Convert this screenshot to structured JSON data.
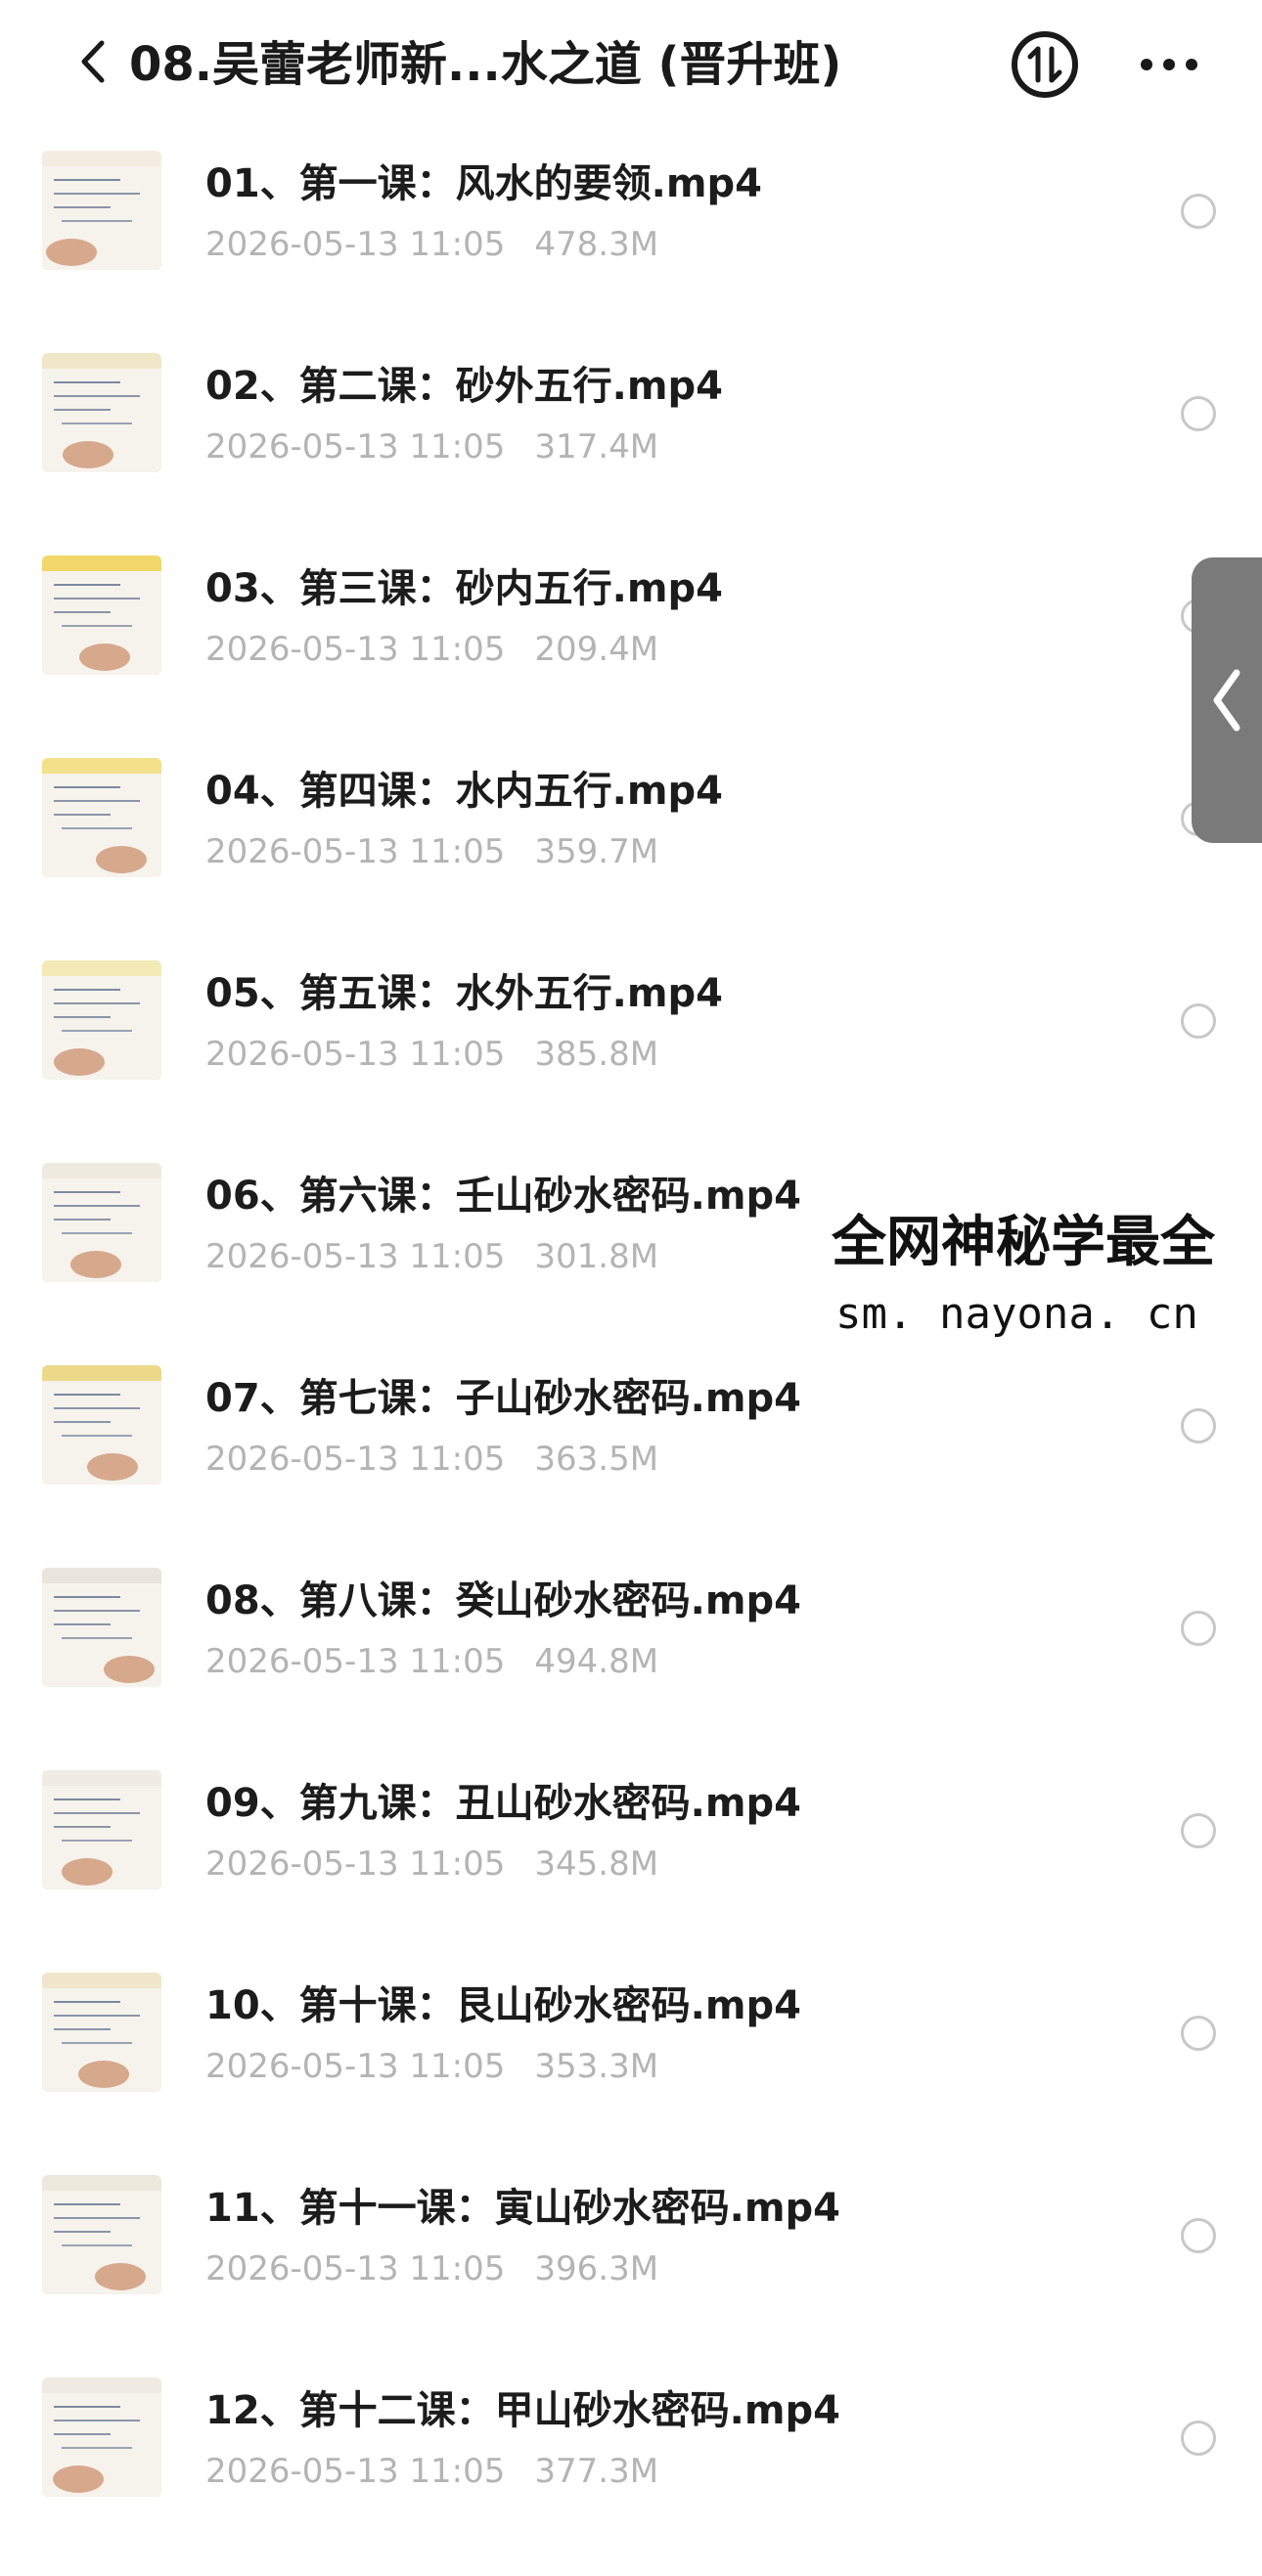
{
  "header": {
    "title": "08.吴蕾老师新...水之道 (晋升班)",
    "back_icon": "chevron-left-icon",
    "sort_icon": "sort-swap-icon",
    "more_icon": "more-dots-icon"
  },
  "files": [
    {
      "name": "01、第一课：风水的要领.mp4",
      "date": "2026-05-13 11:05",
      "size": "478.3M"
    },
    {
      "name": "02、第二课：砂外五行.mp4",
      "date": "2026-05-13 11:05",
      "size": "317.4M"
    },
    {
      "name": "03、第三课：砂内五行.mp4",
      "date": "2026-05-13 11:05",
      "size": "209.4M"
    },
    {
      "name": "04、第四课：水内五行.mp4",
      "date": "2026-05-13 11:05",
      "size": "359.7M"
    },
    {
      "name": "05、第五课：水外五行.mp4",
      "date": "2026-05-13 11:05",
      "size": "385.8M"
    },
    {
      "name": "06、第六课：壬山砂水密码.mp4",
      "date": "2026-05-13 11:05",
      "size": "301.8M"
    },
    {
      "name": "07、第七课：子山砂水密码.mp4",
      "date": "2026-05-13 11:05",
      "size": "363.5M"
    },
    {
      "name": "08、第八课：癸山砂水密码.mp4",
      "date": "2026-05-13 11:05",
      "size": "494.8M"
    },
    {
      "name": "09、第九课：丑山砂水密码.mp4",
      "date": "2026-05-13 11:05",
      "size": "345.8M"
    },
    {
      "name": "10、第十课：艮山砂水密码.mp4",
      "date": "2026-05-13 11:05",
      "size": "353.3M"
    },
    {
      "name": "11、第十一课：寅山砂水密码.mp4",
      "date": "2026-05-13 11:05",
      "size": "396.3M"
    },
    {
      "name": "12、第十二课：甲山砂水密码.mp4",
      "date": "2026-05-13 11:05",
      "size": "377.3M"
    }
  ],
  "watermark": {
    "line1": "全网神秘学最全",
    "line2": "sm. nayona. cn"
  },
  "side_tab": {
    "icon": "chevron-left-icon"
  },
  "colors": {
    "title": "#1a1a1a",
    "meta": "#b4b4b4",
    "radio_border": "#c8c8c8",
    "side_tab": "#7a7a7a"
  }
}
